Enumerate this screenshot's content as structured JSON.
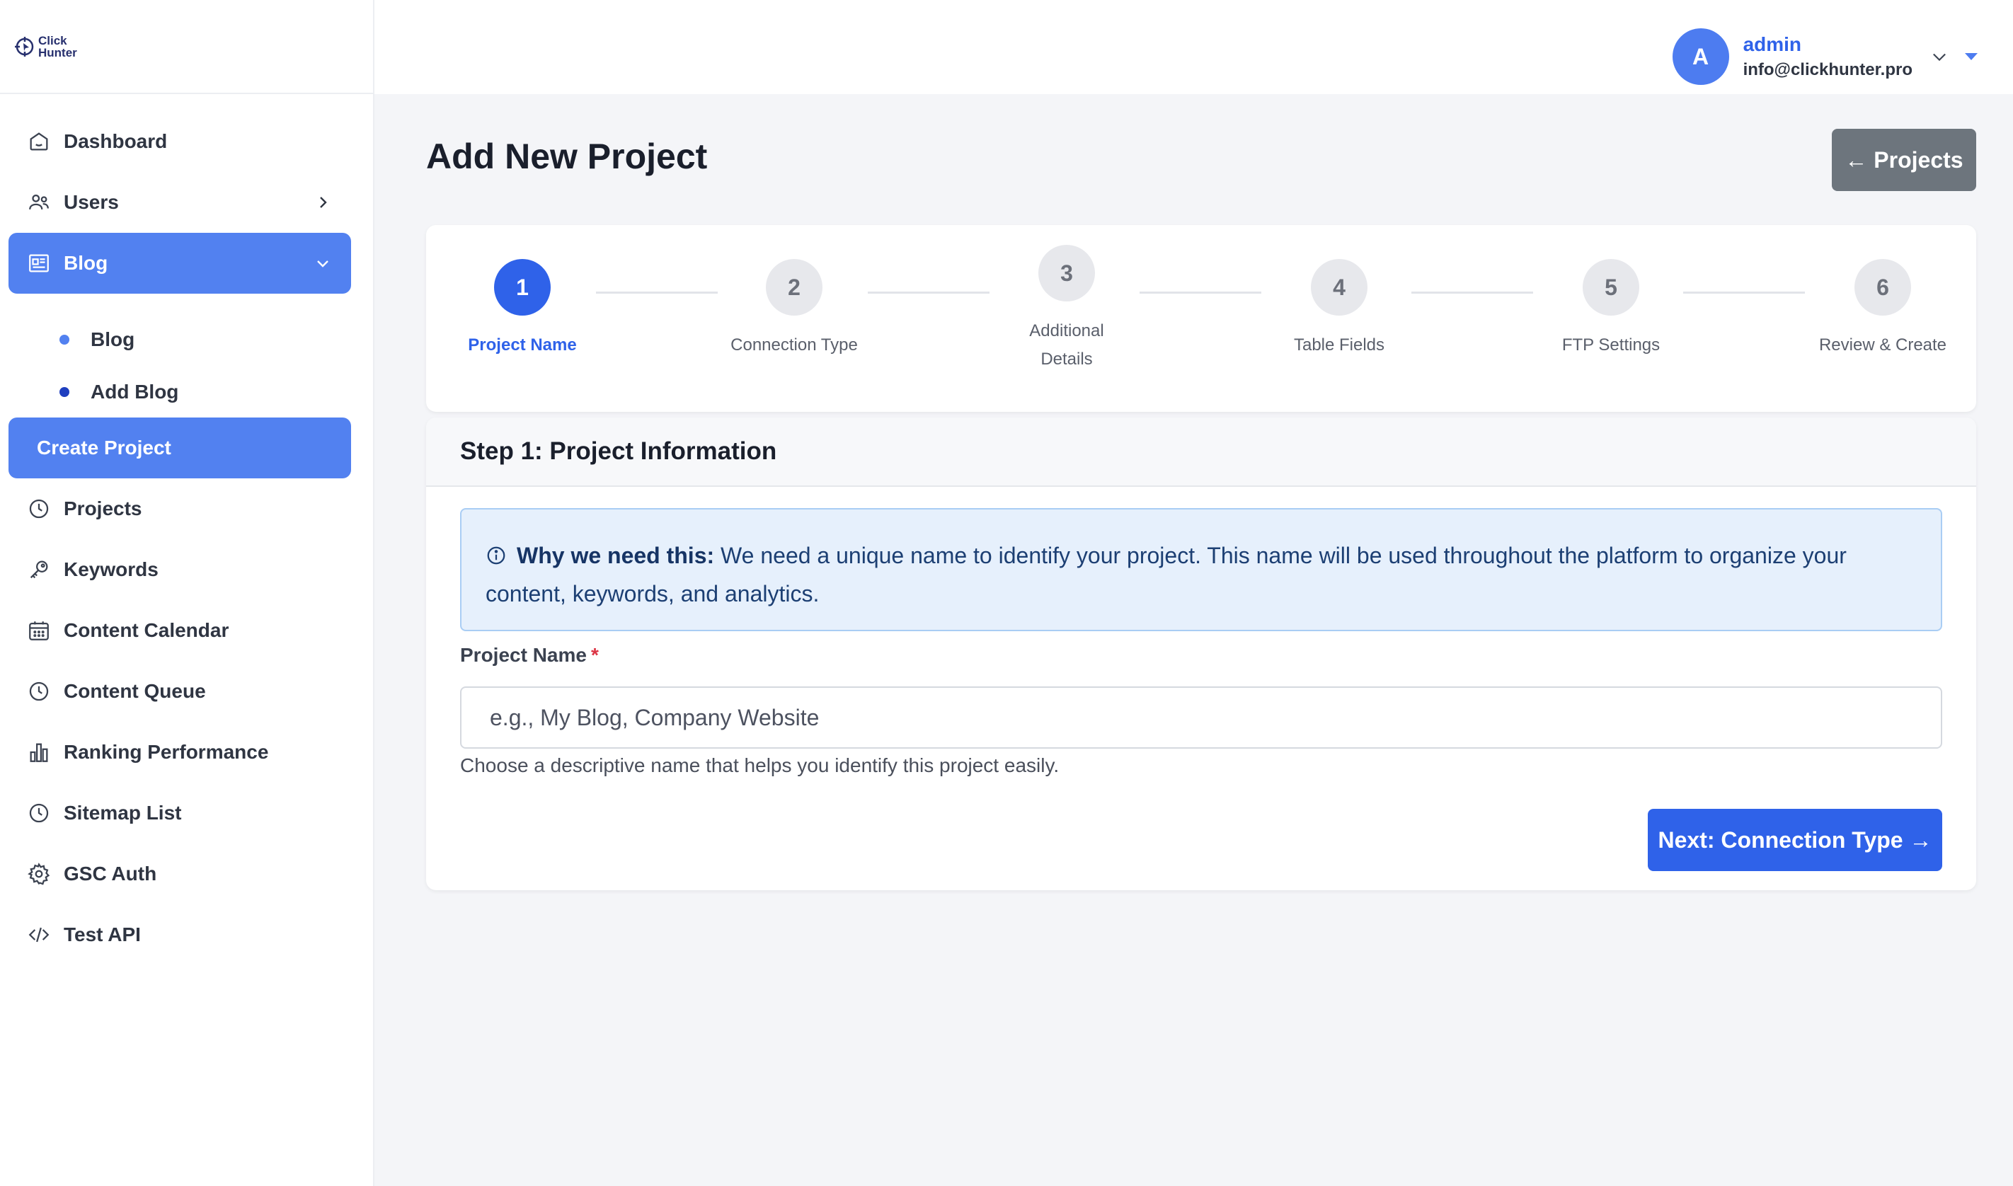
{
  "brand": {
    "line1": "Click",
    "line2": "Hunter"
  },
  "sidebar": {
    "items": [
      {
        "label": "Dashboard",
        "icon": "home-icon"
      },
      {
        "label": "Users",
        "icon": "users-icon"
      },
      {
        "label": "Blog",
        "icon": "newspaper-icon",
        "active": true
      },
      {
        "label": "Projects",
        "icon": "clock-icon"
      },
      {
        "label": "Keywords",
        "icon": "key-icon"
      },
      {
        "label": "Content Calendar",
        "icon": "calendar-icon"
      },
      {
        "label": "Content Queue",
        "icon": "clock-icon"
      },
      {
        "label": "Ranking Performance",
        "icon": "bar-chart-icon"
      },
      {
        "label": "Sitemap List",
        "icon": "clock-icon"
      },
      {
        "label": "GSC Auth",
        "icon": "gear-icon"
      },
      {
        "label": "Test API",
        "icon": "code-icon"
      }
    ],
    "blog_sub": [
      "Blog",
      "Add Blog"
    ],
    "create_project": "Create Project"
  },
  "user": {
    "initial": "A",
    "name": "admin",
    "email": "info@clickhunter.pro"
  },
  "page": {
    "title": "Add New Project",
    "back_button": "← Projects"
  },
  "steps": [
    {
      "number": "1",
      "label": "Project Name",
      "active": true
    },
    {
      "number": "2",
      "label": "Connection Type"
    },
    {
      "number": "3",
      "label_line1": "Additional",
      "label_line2": "Details"
    },
    {
      "number": "4",
      "label": "Table Fields"
    },
    {
      "number": "5",
      "label": "FTP Settings"
    },
    {
      "number": "6",
      "label": "Review & Create"
    }
  ],
  "form": {
    "header": "Step 1: Project Information",
    "info_title": "Why we need this:",
    "info_text": " We need a unique name to identify your project. This name will be used throughout the platform to organize your content, keywords, and analytics.",
    "field_label": "Project Name",
    "required_mark": "*",
    "placeholder": "e.g., My Blog, Company Website",
    "help_text": "Choose a descriptive name that helps you identify this project easily.",
    "next_button": "Next: Connection Type →"
  }
}
